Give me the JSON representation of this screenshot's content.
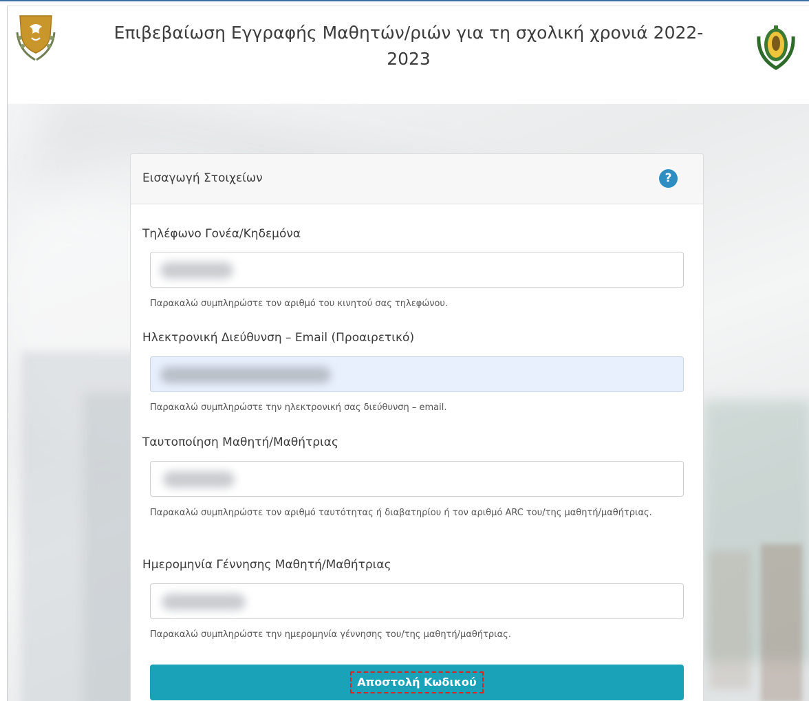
{
  "header": {
    "title": "Επιβεβαίωση Εγγραφής Μαθητών/ριών για τη σχολική χρονιά 2022-2023",
    "left_logo": "cyprus-coat-of-arms-icon",
    "right_logo": "ministry-emblem-icon"
  },
  "panel": {
    "title": "Εισαγωγή Στοιχείων",
    "help_icon": "question-circle-icon",
    "help_glyph": "?"
  },
  "fields": {
    "phone": {
      "label": "Τηλέφωνο Γονέα/Κηδεμόνα",
      "help": "Παρακαλώ συμπληρώστε τον αριθμό του κινητού σας τηλεφώνου."
    },
    "email": {
      "label": "Ηλεκτρονική Διεύθυνση – Email (Προαιρετικό)",
      "help": "Παρακαλώ συμπληρώστε την ηλεκτρονική σας διεύθυνση – email."
    },
    "id": {
      "label": "Ταυτοποίηση Μαθητή/Μαθήτριας",
      "help": "Παρακαλώ συμπληρώστε τον αριθμό ταυτότητας ή διαβατηρίου ή τον αριθμό ARC του/της μαθητή/μαθήτριας."
    },
    "dob": {
      "label": "Ημερομηνία Γέννησης Μαθητή/Μαθήτριας",
      "help": "Παρακαλώ συμπληρώστε την ημερομηνία γέννησης του/της μαθητή/μαθήτριας."
    }
  },
  "submit": {
    "label": "Αποστολή Κωδικού"
  },
  "colors": {
    "submit_bg": "#1aa2b8",
    "help_icon_bg": "#2f8ec1",
    "highlight_border": "#d9231e",
    "autofill_bg": "#e8f0fe"
  }
}
